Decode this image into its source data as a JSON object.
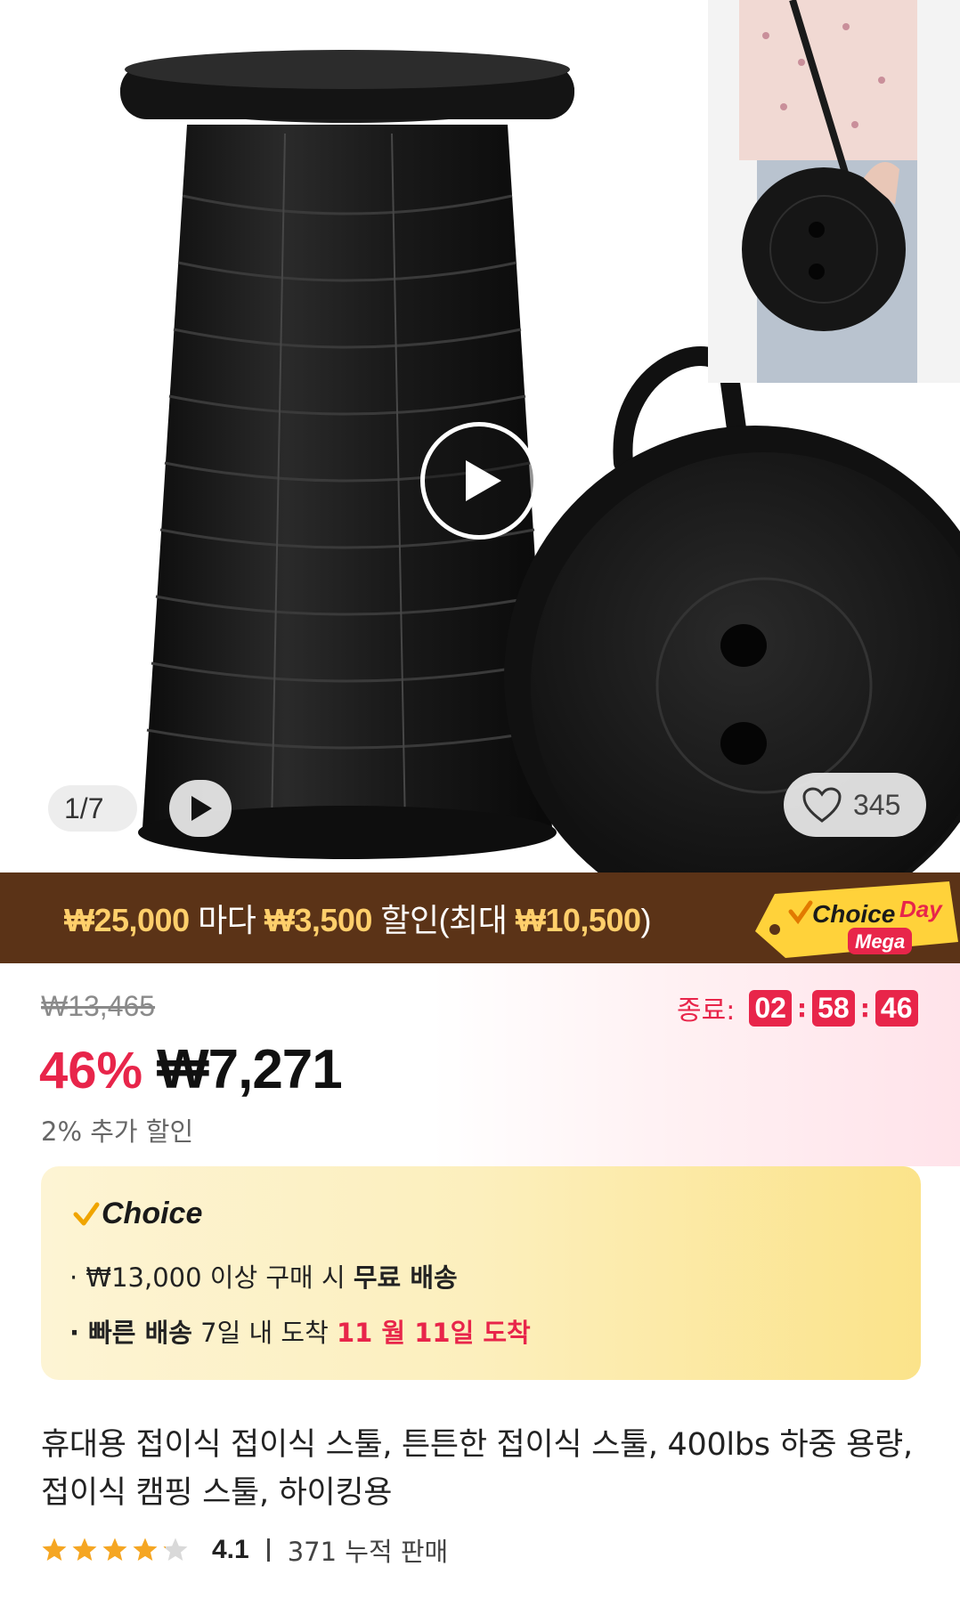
{
  "gallery": {
    "counter": "1/7",
    "favorite_count": "345",
    "icons": [
      "play-icon",
      "video-play-icon",
      "heart-icon"
    ]
  },
  "promo": {
    "part1": "₩25,000",
    "part2": " 마다 ",
    "part3": "₩3,500",
    "part4": " 할인(최대 ",
    "part5": "₩10,500",
    "part6": ")",
    "tag_choice": "Choice",
    "tag_day": "Day",
    "tag_mega": "Mega",
    "colors": {
      "banner": "#5b3317",
      "highlight": "#ffcf6b"
    }
  },
  "pricing": {
    "original_price": "₩13,465",
    "discount": "46%",
    "sale_price": "₩7,271",
    "extra_discount": "2% 추가 할인",
    "timer_label": "종료:",
    "timer": {
      "hours": "02",
      "minutes": "58",
      "seconds": "46"
    },
    "accent_color": "#e8254a"
  },
  "choice": {
    "logo": "Choice",
    "line1_prefix": "· ₩13,000 이상 구매 시 ",
    "line1_bold": "무료 배송",
    "line2_bold": "· 빠른 배송",
    "line2_mid": " 7일 내 도착 ",
    "line2_red": "11 월 11일 도착"
  },
  "product": {
    "title": "휴대용 접이식 접이식 스툴, 튼튼한 접이식 스툴, 400lbs 하중 용량, 접이식 캠핑 스툴, 하이킹용",
    "rating": 4.1,
    "rating_text": "4.1",
    "sold": "371 누적 판매"
  }
}
